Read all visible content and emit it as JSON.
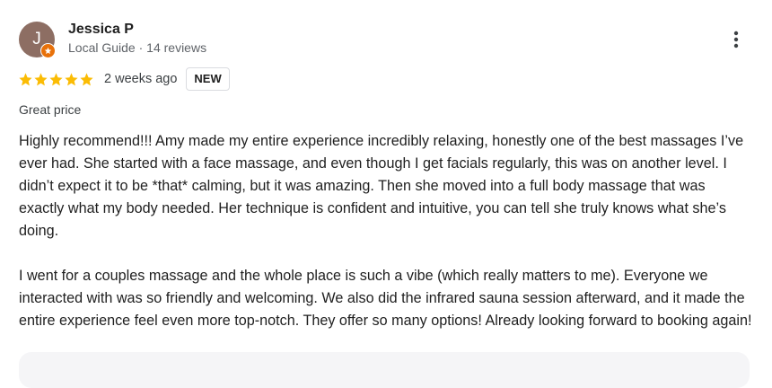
{
  "reviewer": {
    "initial": "J",
    "name": "Jessica P",
    "meta": "Local Guide · 14 reviews",
    "badge_icon": "local-guide-star-icon",
    "avatar_color": "#8d6e63",
    "badge_color": "#e8710a"
  },
  "rating": {
    "stars": 5,
    "max_stars": 5,
    "star_color": "#fbbc04",
    "time_ago": "2 weeks ago",
    "badge": "NEW"
  },
  "review": {
    "tag": "Great price",
    "paragraphs": [
      "Highly recommend!!! Amy made my entire experience incredibly relaxing, honestly one of the best massages I’ve ever had. She started with a face massage, and even though I get facials regularly, this was on another level. I didn’t expect it to be *that* calming, but it was amazing. Then she moved into a full body massage that was exactly what my body needed. Her technique is confident and intuitive, you can tell she truly knows what she’s doing.",
      "I went for a couples massage and the whole place is such a vibe (which really matters to me). Everyone we interacted with was so friendly and welcoming. We also did the infrared sauna session afterward, and it made the entire experience feel even more top-notch. They offer so many options! Already looking forward to booking again!"
    ]
  },
  "actions": {
    "more_icon": "more-vertical-icon"
  }
}
